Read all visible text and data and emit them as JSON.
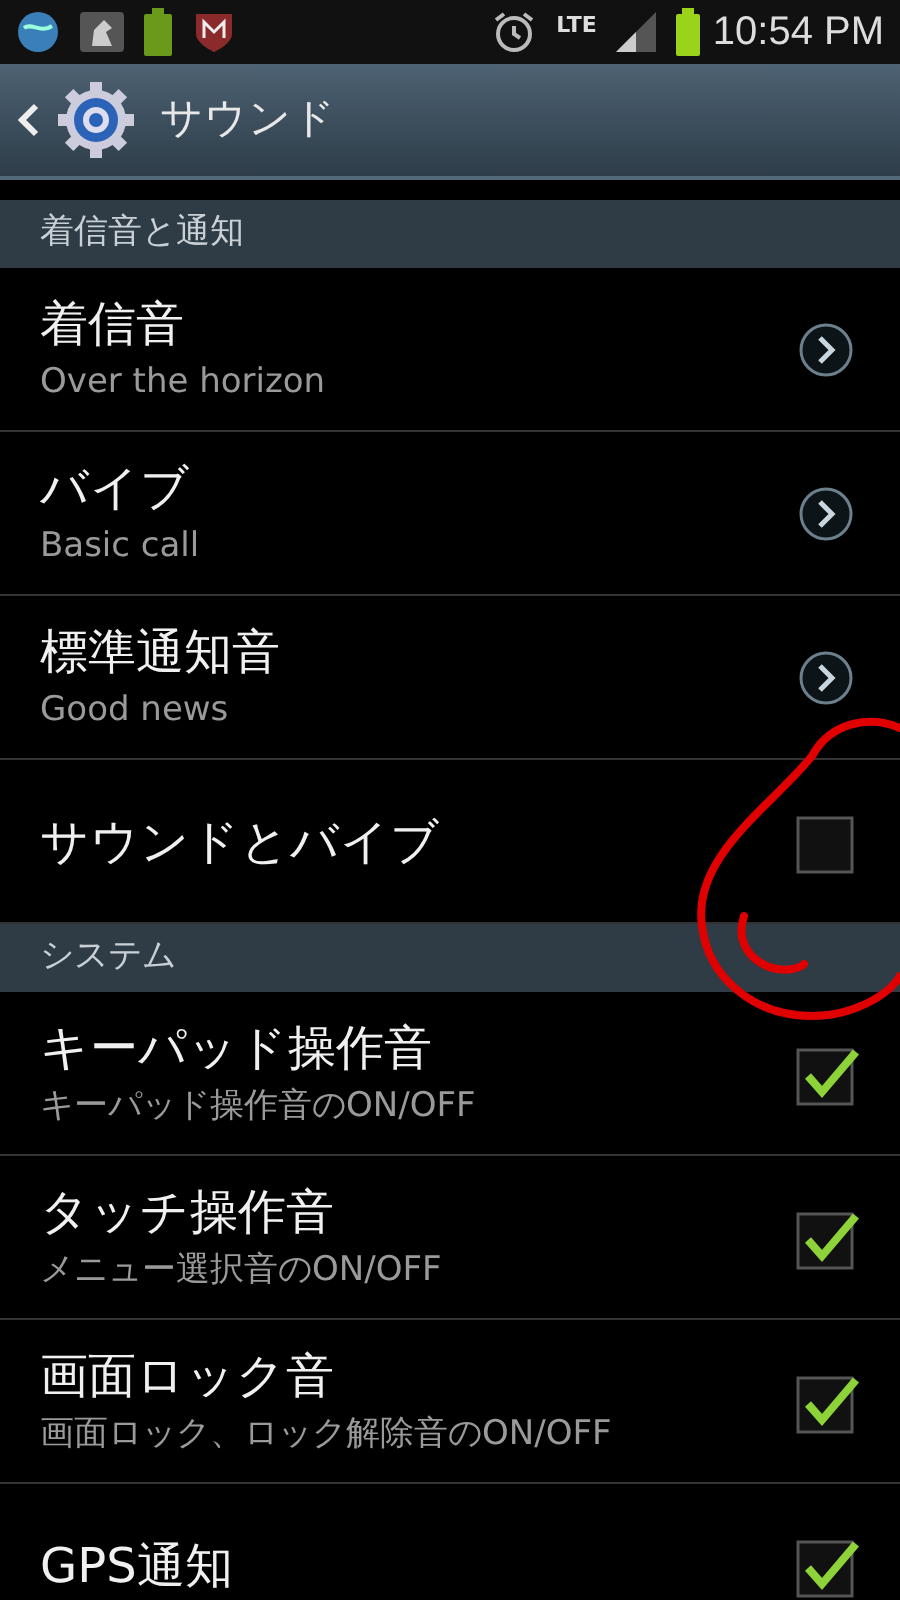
{
  "status_bar": {
    "network": "LTE",
    "time": "10:54 PM"
  },
  "action_bar": {
    "title": "サウンド"
  },
  "sections": [
    {
      "header": "着信音と通知",
      "items": [
        {
          "kind": "link",
          "title": "着信音",
          "summary": "Over the horizon"
        },
        {
          "kind": "link",
          "title": "バイブ",
          "summary": "Basic call"
        },
        {
          "kind": "link",
          "title": "標準通知音",
          "summary": "Good news"
        },
        {
          "kind": "checkbox",
          "title": "サウンドとバイブ",
          "checked": false
        }
      ]
    },
    {
      "header": "システム",
      "items": [
        {
          "kind": "checkbox",
          "title": "キーパッド操作音",
          "summary": "キーパッド操作音のON/OFF",
          "checked": true
        },
        {
          "kind": "checkbox",
          "title": "タッチ操作音",
          "summary": "メニュー選択音のON/OFF",
          "checked": true
        },
        {
          "kind": "checkbox",
          "title": "画面ロック音",
          "summary": "画面ロック、ロック解除音のON/OFF",
          "checked": true
        },
        {
          "kind": "checkbox",
          "title": "GPS通知",
          "checked": true
        }
      ]
    }
  ]
}
